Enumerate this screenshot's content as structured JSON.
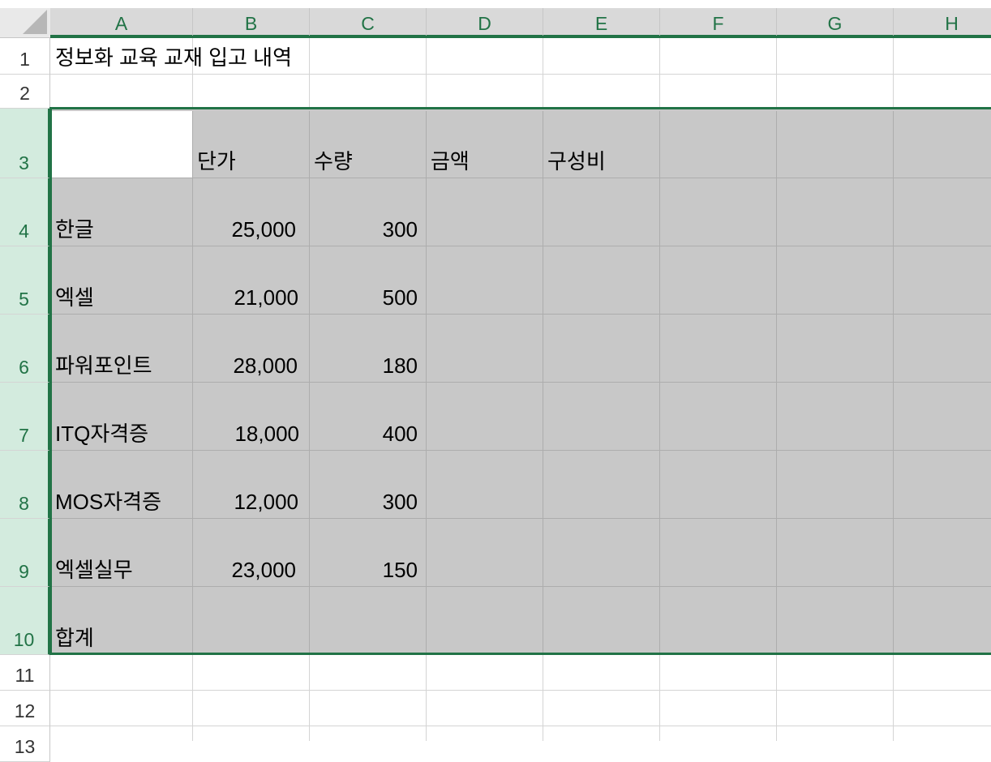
{
  "columns": [
    "A",
    "B",
    "C",
    "D",
    "E",
    "F",
    "G",
    "H"
  ],
  "rows": [
    "1",
    "2",
    "3",
    "4",
    "5",
    "6",
    "7",
    "8",
    "9",
    "10",
    "11",
    "12",
    "13"
  ],
  "title": "정보화 교육 교재 입고 내역",
  "header": {
    "b": "단가",
    "c": "수량",
    "d": "금액",
    "e": "구성비"
  },
  "items": [
    {
      "name": "한글",
      "price": "25,000",
      "qty": "300"
    },
    {
      "name": "엑셀",
      "price": "21,000",
      "qty": "500"
    },
    {
      "name": "파워포인트",
      "price": "28,000",
      "qty": "180"
    },
    {
      "name": "ITQ자격증",
      "price": "18,000",
      "qty": "400"
    },
    {
      "name": "MOS자격증",
      "price": "12,000",
      "qty": "300"
    },
    {
      "name": "엑셀실무",
      "price": "23,000",
      "qty": "150"
    }
  ],
  "total_label": "합계",
  "selection": "A3:H10",
  "colors": {
    "accent": "#217346",
    "fill": "#c8c8c8",
    "row_header_selected": "#d3ebde"
  }
}
